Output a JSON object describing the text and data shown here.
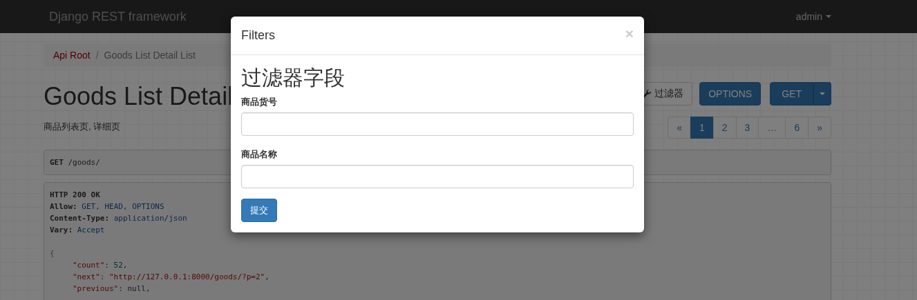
{
  "navbar": {
    "brand": "Django REST framework",
    "user": "admin"
  },
  "breadcrumb_separator": "/",
  "breadcrumb": [
    {
      "label": "Api Root",
      "selected": false
    },
    {
      "label": "Goods List Detail List",
      "selected": true
    }
  ],
  "page": {
    "title": "Goods List Detail",
    "description": "商品列表页, 详细页"
  },
  "actions": {
    "filter_button": "过滤器",
    "options_button": "OPTIONS",
    "get_button": "GET"
  },
  "pagination": [
    {
      "label": "«",
      "selected": false,
      "disabled": false
    },
    {
      "label": "1",
      "selected": true,
      "disabled": false
    },
    {
      "label": "2",
      "selected": false,
      "disabled": false
    },
    {
      "label": "3",
      "selected": false,
      "disabled": false
    },
    {
      "label": "…",
      "selected": false,
      "disabled": true
    },
    {
      "label": "6",
      "selected": false,
      "disabled": false
    },
    {
      "label": "»",
      "selected": false,
      "disabled": false
    }
  ],
  "request": {
    "method": "GET",
    "path": "/goods/"
  },
  "response": [
    {
      "kind": "header",
      "segments": [
        {
          "kind": "bold",
          "text": "HTTP 200 OK"
        }
      ]
    },
    {
      "kind": "header",
      "segments": [
        {
          "kind": "bold",
          "text": "Allow:"
        },
        {
          "kind": "value",
          "text": " GET, HEAD, OPTIONS"
        }
      ]
    },
    {
      "kind": "header",
      "segments": [
        {
          "kind": "bold",
          "text": "Content-Type:"
        },
        {
          "kind": "value",
          "text": " application/json"
        }
      ]
    },
    {
      "kind": "header",
      "segments": [
        {
          "kind": "bold",
          "text": "Vary:"
        },
        {
          "kind": "value",
          "text": " Accept"
        }
      ]
    },
    {
      "kind": "blank"
    },
    {
      "kind": "brace",
      "segments": [
        {
          "kind": "punct",
          "text": "{"
        }
      ]
    },
    {
      "kind": "member",
      "segments": [
        {
          "kind": "key",
          "text": "\"count\""
        },
        {
          "kind": "plain",
          "text": ": "
        },
        {
          "kind": "number",
          "text": "52"
        },
        {
          "kind": "plain",
          "text": ","
        }
      ]
    },
    {
      "kind": "member",
      "segments": [
        {
          "kind": "key",
          "text": "\"next\""
        },
        {
          "kind": "plain",
          "text": ": "
        },
        {
          "kind": "string",
          "text": "\"http://127.0.0.1:8000/goods/?p=2\""
        },
        {
          "kind": "plain",
          "text": ","
        }
      ]
    },
    {
      "kind": "member",
      "segments": [
        {
          "kind": "key",
          "text": "\"previous\""
        },
        {
          "kind": "plain",
          "text": ": "
        },
        {
          "kind": "literal",
          "text": "null"
        },
        {
          "kind": "plain",
          "text": ","
        }
      ]
    }
  ],
  "modal": {
    "title": "Filters",
    "close": "×",
    "heading": "过滤器字段",
    "fields": [
      {
        "label": "商品货号"
      },
      {
        "label": "商品名称"
      }
    ],
    "submit": "提交"
  }
}
